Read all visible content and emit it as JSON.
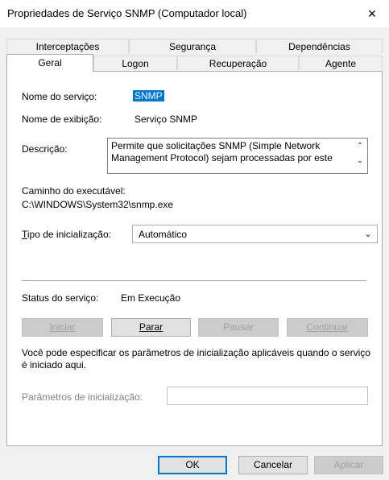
{
  "window": {
    "title": "Propriedades de Serviço SNMP (Computador local)",
    "close_icon": "×"
  },
  "tabs_row1": [
    {
      "label": "Interceptações"
    },
    {
      "label": "Segurança"
    },
    {
      "label": "Dependências"
    }
  ],
  "tabs_row2": [
    {
      "label": "Geral"
    },
    {
      "label": "Logon"
    },
    {
      "label": "Recuperação"
    },
    {
      "label": "Agente"
    }
  ],
  "general": {
    "service_name_label": "Nome do serviço:",
    "service_name_value": "SNMP",
    "display_name_label": "Nome de exibição:",
    "display_name_value": "Serviço SNMP",
    "description_label": "Descrição:",
    "description_value": "Permite que solicitações SNMP (Simple Network Management Protocol) sejam processadas por este",
    "exe_path_label": "Caminho do executável:",
    "exe_path_value": "C:\\WINDOWS\\System32\\snmp.exe",
    "startup_type_label_first": "T",
    "startup_type_label_rest": "ipo de inicialização:",
    "startup_type_value": "Automático",
    "status_label": "Status do serviço:",
    "status_value": "Em Execução",
    "help_text": "Você pode especificar os parâmetros de inicialização aplicáveis quando o serviço é iniciado aqui.",
    "params_label_a": "Parâmetros de inicialização:"
  },
  "service_buttons": {
    "start": "Iniciar",
    "stop": "Parar",
    "pause": "Pausar",
    "continue": "Continuar"
  },
  "dialog_buttons": {
    "ok": "OK",
    "cancel": "Cancelar",
    "apply": "Aplicar"
  }
}
